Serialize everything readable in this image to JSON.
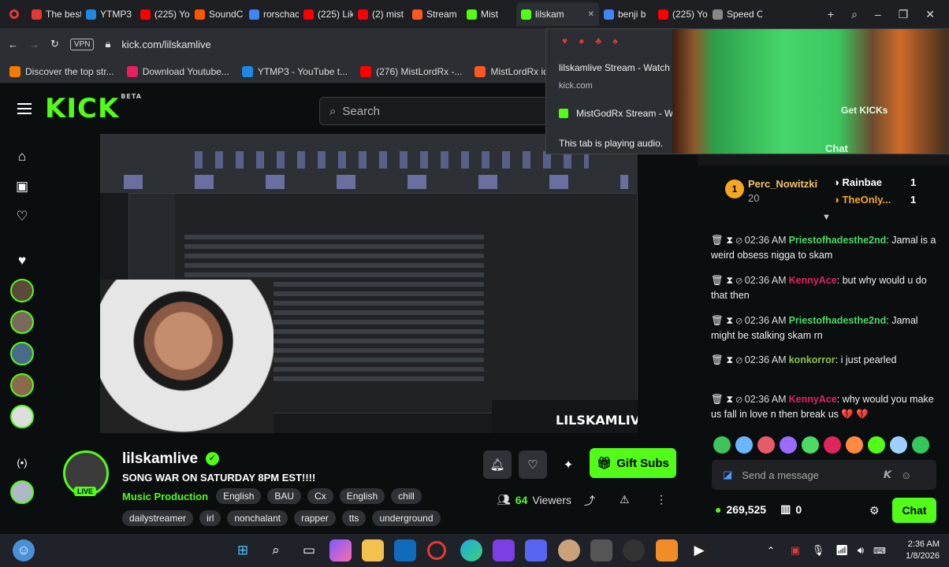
{
  "browser": {
    "tabs": [
      {
        "label": "The best",
        "color": "#e53935"
      },
      {
        "label": "YTMP3",
        "color": "#1e88e5"
      },
      {
        "label": "(225) Yo",
        "color": "#ff0000"
      },
      {
        "label": "SoundC",
        "color": "#ff5500"
      },
      {
        "label": "rorschac",
        "color": "#4285f4"
      },
      {
        "label": "(225) Lik",
        "color": "#ff0000"
      },
      {
        "label": "(2) mist",
        "color": "#ff0000"
      },
      {
        "label": "Stream",
        "color": "#ff5722"
      },
      {
        "label": "Mist",
        "color": "#53fc18"
      },
      {
        "label": "lilskam",
        "color": "#53fc18",
        "active": true
      },
      {
        "label": "benji b",
        "color": "#4285f4"
      },
      {
        "label": "(225) Yo",
        "color": "#ff0000"
      },
      {
        "label": "Speed C",
        "color": "#888888"
      }
    ],
    "vpn_label": "VPN",
    "url": "kick.com/lilskamlive",
    "bookmarks": [
      {
        "label": "Discover the top str...",
        "color": "#f57c00"
      },
      {
        "label": "Download Youtube...",
        "color": "#e91e63"
      },
      {
        "label": "YTMP3 - YouTube t...",
        "color": "#1e88e5"
      },
      {
        "label": "(276) MistLordRx -...",
        "color": "#ff0000"
      },
      {
        "label": "MistLordRx idek...",
        "color": "#ff5722"
      }
    ]
  },
  "tab_preview": {
    "title": "lilskamlive Stream - Watch Live on Kick",
    "domain": "kick.com",
    "sub_title": "MistGodRx Stream - Watch Live on Kick",
    "audio_note": "This tab is playing audio.",
    "preview_overlay_1": "Get KICKs",
    "preview_overlay_2": "Chat"
  },
  "kick": {
    "logo": "KICK",
    "logo_badge": "BETA",
    "search_placeholder": "Search",
    "overlay_name": "LILSKAMLIVE",
    "channel": {
      "name": "lilskamlive",
      "live_badge": "LIVE",
      "stream_title": "SONG WAR ON SATURDAY 8PM EST!!!!",
      "category": "Music Production",
      "tags_row1": [
        "English",
        "BAU",
        "Cx",
        "English",
        "chill"
      ],
      "tags_row2": [
        "dailystreamer",
        "irl",
        "nonchalant",
        "rapper",
        "tts",
        "underground"
      ],
      "viewers": "64",
      "viewers_label": "Viewers",
      "gift_label": "Gift Subs"
    }
  },
  "chat": {
    "top_gifter": {
      "rank": "1",
      "name": "Perc_Nowitzki",
      "count": "20"
    },
    "gifter2": {
      "name": "Rainbae",
      "count": "1"
    },
    "gifter3": {
      "name": "TheOnly...",
      "count": "1"
    },
    "messages": [
      {
        "time": "02:36 AM",
        "user": "Priestofhadesthe2nd",
        "color": "#4cd964",
        "text": "Jamal is a weird obsess nigga to skam"
      },
      {
        "time": "02:36 AM",
        "user": "KennyAce",
        "color": "#e0245e",
        "text": "but why would u do that then"
      },
      {
        "time": "02:36 AM",
        "user": "Priestofhadesthe2nd",
        "color": "#4cd964",
        "text": "Jamal might be stalking skam rn"
      },
      {
        "time": "02:36 AM",
        "user": "konkorror",
        "color": "#8bc34a",
        "text": "i just pearled"
      },
      {
        "time": "02:36 AM",
        "user": "KennyAce",
        "color": "#e0245e",
        "text": "why would you make us fall in love n then break us 💔 💔"
      }
    ],
    "input_placeholder": "Send a message",
    "points": "269,525",
    "gifts": "0",
    "chat_button": "Chat"
  },
  "taskbar": {
    "time": "2:36 AM",
    "date": "1/8/2026"
  }
}
